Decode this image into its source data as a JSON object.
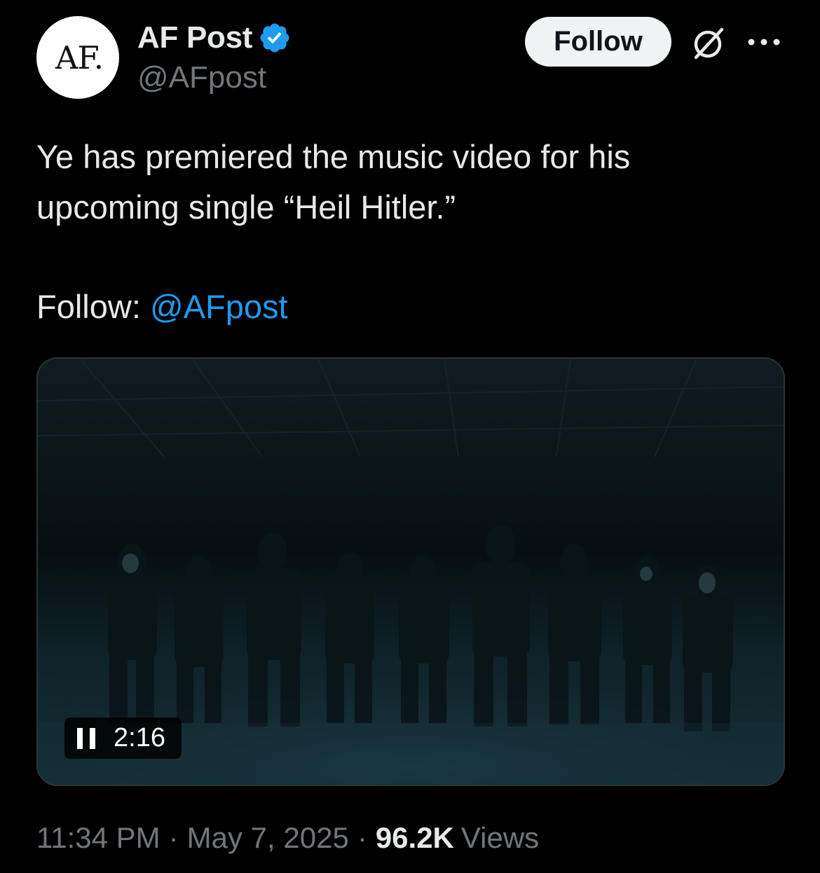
{
  "author": {
    "avatar_text": "AF.",
    "display_name": "AF Post",
    "handle": "@AFpost",
    "verified": true
  },
  "actions": {
    "follow_label": "Follow",
    "grok_icon": "grok-icon",
    "more_icon": "more-icon"
  },
  "tweet": {
    "text_line1": "Ye has premiered the music video for his",
    "text_line2": "upcoming single “Heil Hitler.”",
    "follow_prefix": "Follow:",
    "follow_mention": "@AFpost"
  },
  "video": {
    "state_icon": "pause-icon",
    "duration": "2:16"
  },
  "meta": {
    "time": "11:34 PM",
    "date": "May 7, 2025",
    "views_count": "96.2K",
    "views_label": "Views",
    "separator": "·"
  },
  "colors": {
    "background": "#000000",
    "text_primary": "#e7e9ea",
    "text_secondary": "#71767b",
    "accent_link": "#1d9bf0",
    "verified_badge": "#1d9bf0",
    "follow_button_bg": "#eff3f4"
  }
}
